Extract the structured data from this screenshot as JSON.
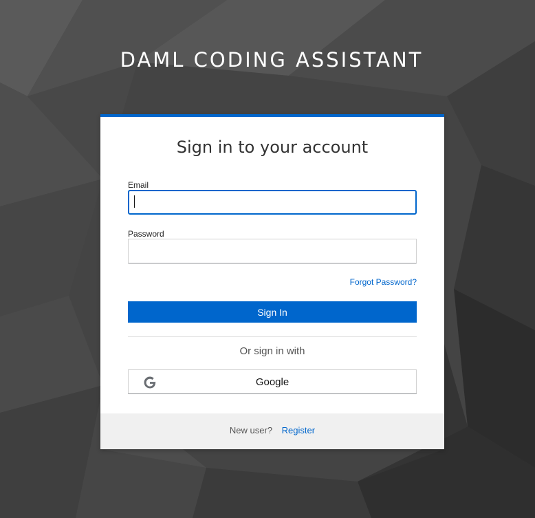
{
  "app_title": "DAML CODING ASSISTANT",
  "card": {
    "title": "Sign in to your account",
    "accent_color": "#0066cc"
  },
  "email": {
    "label": "Email",
    "value": ""
  },
  "password": {
    "label": "Password",
    "value": ""
  },
  "forgot_password": "Forgot Password?",
  "sign_in_button": "Sign In",
  "social": {
    "divider_text": "Or sign in with",
    "google_label": "Google",
    "google_icon": "google-icon"
  },
  "footer": {
    "new_user_text": "New user?",
    "register_link": "Register"
  }
}
